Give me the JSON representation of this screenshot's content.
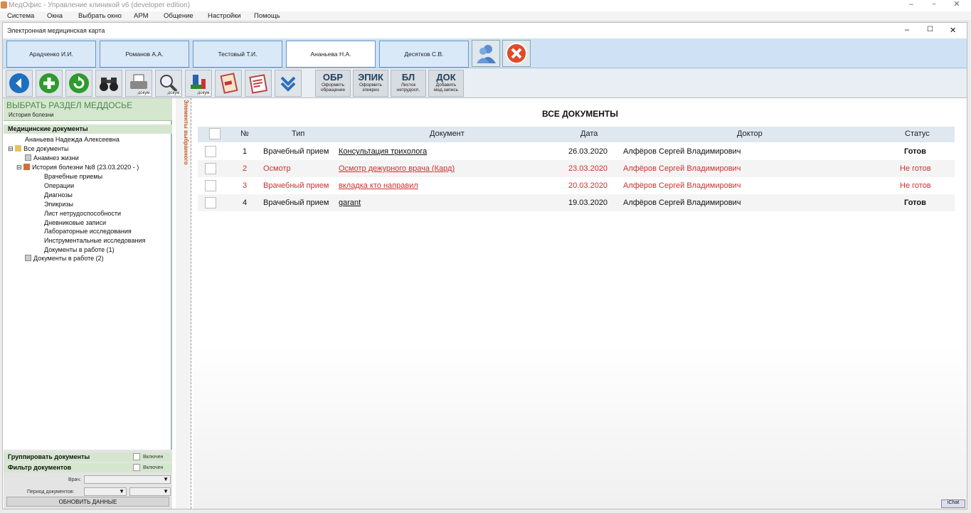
{
  "app_title": "МедОфис - Управление клиникой v6 (developer edition)",
  "menu": [
    "Система",
    "Окна",
    "Выбрать окно",
    "АРМ",
    "Общение",
    "Настройки",
    "Помощь"
  ],
  "window_title": "Электронная медицинская карта",
  "patient_tabs": [
    "Арадченко И.И.",
    "Романов А.А.",
    "Тестовый Т.И.",
    "Ананьева Н.А.",
    "Десятков С.В."
  ],
  "active_tab_index": 3,
  "toolbar": {
    "docum_label": "докум."
  },
  "doc_buttons": [
    {
      "code": "ОБР",
      "l1": "Оформить",
      "l2": "обращение"
    },
    {
      "code": "ЭПИК",
      "l1": "Оформить",
      "l2": "эпикриз"
    },
    {
      "code": "БЛ",
      "l1": "Листок",
      "l2": "нетрудосп."
    },
    {
      "code": "ДОК",
      "l1": "Добавить",
      "l2": "мед.запись"
    }
  ],
  "left": {
    "header": "ВЫБРАТЬ РАЗДЕЛ МЕДДОСЬЕ",
    "subheader": "История болезни",
    "section": "Медицинские документы",
    "patient": "Ананьева Надежда Алексеевна",
    "all_docs": "Все документы",
    "anamnesis": "Анамнез жизни",
    "history": "История болезни №8 (23.03.2020 - )",
    "history_items": [
      "Врачебные приемы",
      "Операции",
      "Диагнозы",
      "Эпикризы",
      "Лист нетрудоспособности",
      "Дневниковые записи",
      "Лабораторные исследования",
      "Инструментальные исследования",
      "Документы в работе (1)"
    ],
    "docs_in_work": "Документы в работе (2)",
    "group_label": "Группировать документы",
    "filter_label": "Фильтр документов",
    "enabled": "Включен",
    "doctor_label": "Врач:",
    "period_label": "Период документов:",
    "update_button": "ОБНОВИТЬ ДАННЫЕ"
  },
  "splitter_label": "Элементы выбранного",
  "content": {
    "title": "ВСЕ ДОКУМЕНТЫ",
    "columns": [
      "№",
      "Тип",
      "Документ",
      "Дата",
      "Доктор",
      "Статус"
    ],
    "rows": [
      {
        "n": "1",
        "type": "Врачебный прием",
        "doc": "Консультация трихолога",
        "date": "26.03.2020",
        "doctor": "Алфёров Сергей Владимирович",
        "status": "Готов",
        "red": false
      },
      {
        "n": "2",
        "type": "Осмотр",
        "doc": "Осмотр дежурного врача (Кард)",
        "date": "23.03.2020",
        "doctor": "Алфёров Сергей Владимирович",
        "status": "Не готов",
        "red": true
      },
      {
        "n": "3",
        "type": "Врачебный прием",
        "doc": "вкладка кто направил",
        "date": "20.03.2020",
        "doctor": "Алфёров Сергей Владимирович",
        "status": "Не готов",
        "red": true
      },
      {
        "n": "4",
        "type": "Врачебный прием",
        "doc": "garant",
        "date": "19.03.2020",
        "doctor": "Алфёров Сергей Владимирович",
        "status": "Готов",
        "red": false
      }
    ]
  },
  "ichat": "iChat",
  "colors": {
    "accent": "#4b8a4e",
    "tab_bg": "#cfe2f5",
    "red": "#d03030"
  }
}
